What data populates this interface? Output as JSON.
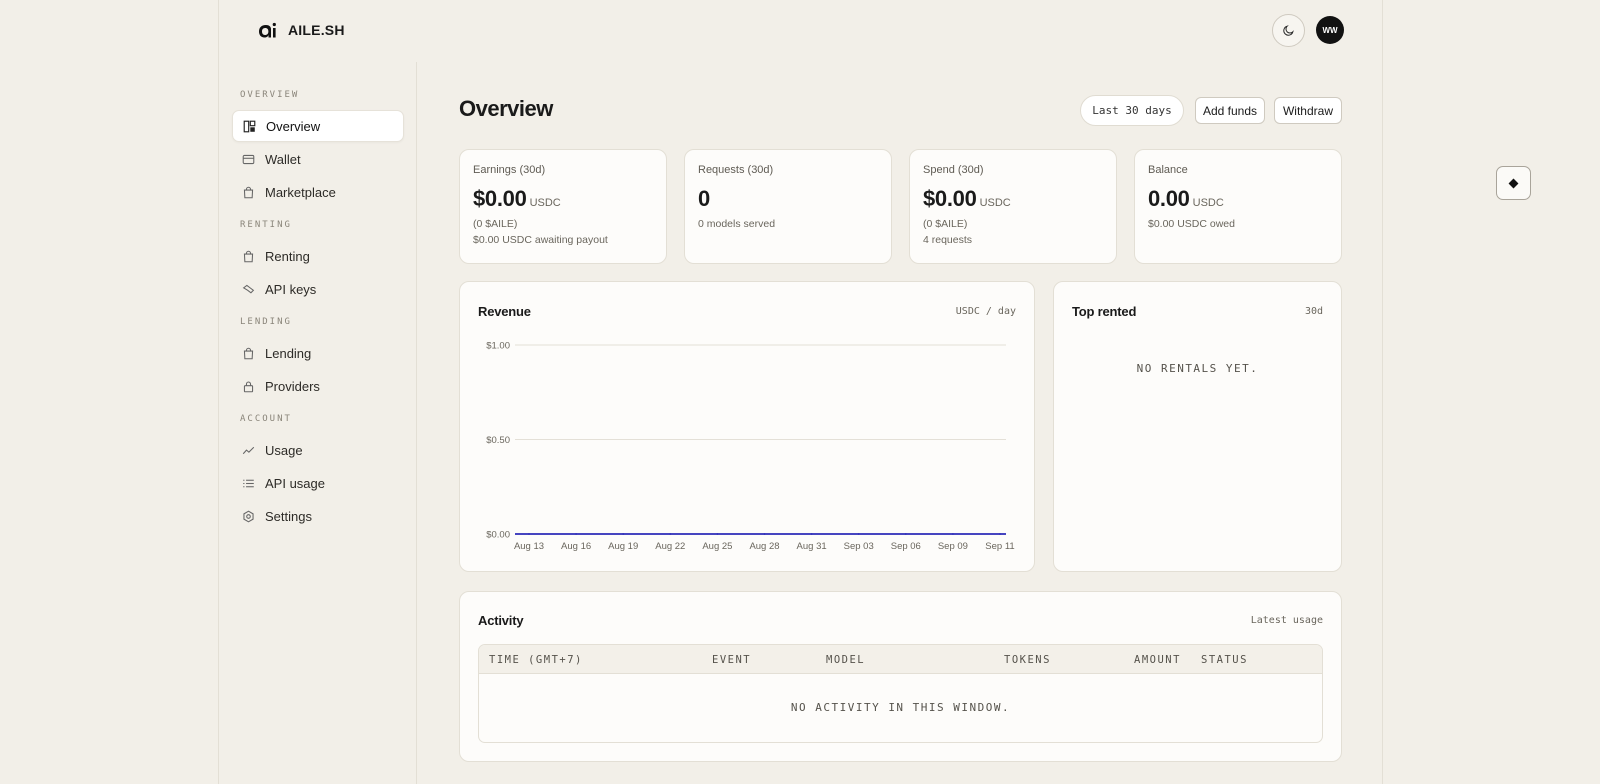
{
  "brand": {
    "name": "AILE.SH"
  },
  "header": {
    "avatar_initials": "WW"
  },
  "sidebar": {
    "sections": [
      {
        "label": "OVERVIEW",
        "items": [
          {
            "label": "Overview",
            "icon": "grid-icon",
            "active": true
          },
          {
            "label": "Wallet",
            "icon": "wallet-icon"
          },
          {
            "label": "Marketplace",
            "icon": "bag-icon"
          }
        ]
      },
      {
        "label": "RENTING",
        "items": [
          {
            "label": "Renting",
            "icon": "bag-icon"
          },
          {
            "label": "API keys",
            "icon": "key-icon"
          }
        ]
      },
      {
        "label": "LENDING",
        "items": [
          {
            "label": "Lending",
            "icon": "bag-icon"
          },
          {
            "label": "Providers",
            "icon": "lock-icon"
          }
        ]
      },
      {
        "label": "ACCOUNT",
        "items": [
          {
            "label": "Usage",
            "icon": "trend-icon"
          },
          {
            "label": "API usage",
            "icon": "list-icon"
          },
          {
            "label": "Settings",
            "icon": "gear-icon"
          }
        ]
      }
    ]
  },
  "main": {
    "title": "Overview",
    "range": "Last 30 days",
    "add_funds": "Add funds",
    "withdraw": "Withdraw"
  },
  "stats": [
    {
      "label": "Earnings (30d)",
      "value": "$0.00",
      "unit": "USDC",
      "sub1": "(0 $AILE)",
      "sub2": "$0.00 USDC awaiting payout"
    },
    {
      "label": "Requests (30d)",
      "value": "0",
      "unit": "",
      "sub1": "0 models served",
      "sub2": ""
    },
    {
      "label": "Spend (30d)",
      "value": "$0.00",
      "unit": "USDC",
      "sub1": "(0 $AILE)",
      "sub2": "4 requests"
    },
    {
      "label": "Balance",
      "value": "0.00",
      "unit": "USDC",
      "sub1": "$0.00 USDC owed",
      "sub2": ""
    }
  ],
  "revenue": {
    "title": "Revenue",
    "meta": "USDC / day"
  },
  "chart_data": {
    "type": "line",
    "title": "Revenue",
    "ylabel": "",
    "xlabel": "",
    "ylim": [
      0,
      1
    ],
    "yticks": [
      "$0.00",
      "$0.50",
      "$1.00"
    ],
    "x": [
      "Aug 13",
      "Aug 16",
      "Aug 19",
      "Aug 22",
      "Aug 25",
      "Aug 28",
      "Aug 31",
      "Sep 03",
      "Sep 06",
      "Sep 09",
      "Sep 11"
    ],
    "series": [
      {
        "values": [
          0,
          0,
          0,
          0,
          0,
          0,
          0,
          0,
          0,
          0,
          0
        ],
        "color": "#2b2bb8"
      }
    ],
    "grid": true
  },
  "top_rented": {
    "title": "Top rented",
    "meta": "30d",
    "empty": "NO RENTALS YET."
  },
  "activity": {
    "title": "Activity",
    "meta": "Latest usage",
    "columns": [
      "TIME (GMT+7)",
      "EVENT",
      "MODEL",
      "TOKENS",
      "AMOUNT",
      "STATUS"
    ],
    "empty": "NO ACTIVITY IN THIS WINDOW."
  }
}
